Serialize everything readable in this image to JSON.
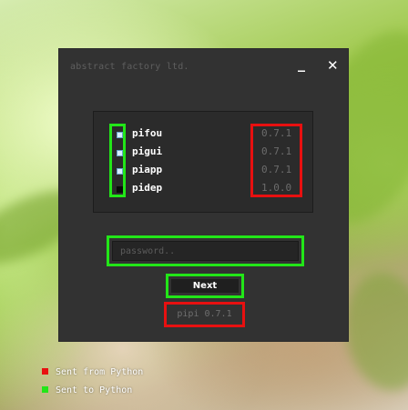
{
  "window": {
    "title": "abstract factory ltd.",
    "minimize_label": "_",
    "close_label": "✕"
  },
  "packages": [
    {
      "name": "pifou",
      "version": "0.7.1",
      "installed": true
    },
    {
      "name": "pigui",
      "version": "0.7.1",
      "installed": true
    },
    {
      "name": "piapp",
      "version": "0.7.1",
      "installed": true
    },
    {
      "name": "pidep",
      "version": "1.0.0",
      "installed": false
    }
  ],
  "password": {
    "placeholder": "password..",
    "value": ""
  },
  "next_button_label": "Next",
  "app_version_label": "pipi 0.7.1",
  "legend": [
    {
      "label": "Sent from Python",
      "color": "#e81010"
    },
    {
      "label": "Sent to Python",
      "color": "#22e618"
    }
  ],
  "colors": {
    "window_bg": "#323232",
    "highlight_green": "#22e618",
    "highlight_red": "#e81010"
  }
}
